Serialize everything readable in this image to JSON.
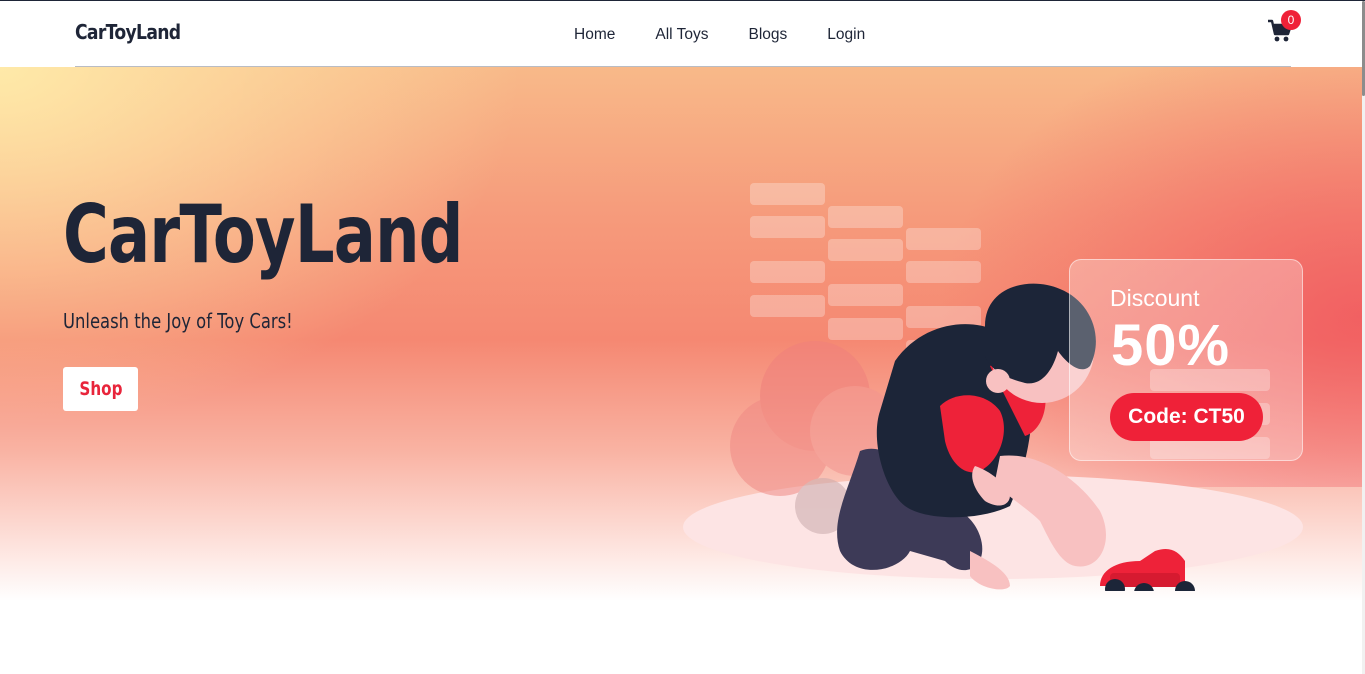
{
  "navbar": {
    "brand": "CarToyLand",
    "links": [
      "Home",
      "All Toys",
      "Blogs",
      "Login"
    ],
    "cart_count": "0"
  },
  "hero": {
    "title": "CarToyLand",
    "subtitle": "Unleash the Joy of Toy Cars!",
    "shop_label": "Shop"
  },
  "promo": {
    "label": "Discount",
    "value": "50%",
    "code": "Code: CT50"
  },
  "colors": {
    "accent": "#ef2138",
    "dark": "#1e2537",
    "peach": "#f69a7b"
  },
  "icons": [
    "cart-icon",
    "child-playing-illustration"
  ]
}
